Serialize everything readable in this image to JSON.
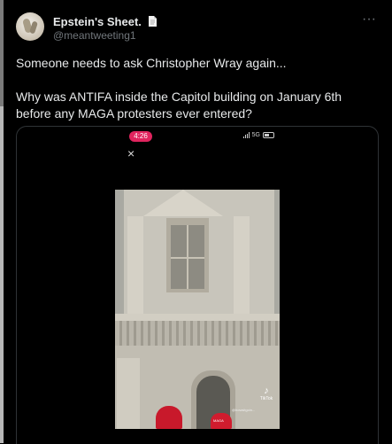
{
  "author": {
    "display_name": "Epstein's Sheet.",
    "handle": "@meantweeting1",
    "avatar_icon": "avatar-image",
    "badge_icon": "document-emoji-icon"
  },
  "header": {
    "more_icon": "more-icon",
    "more_label": "···"
  },
  "tweet": {
    "line1": "Someone needs to ask Christopher Wray again...",
    "line2": "Why was ANTIFA inside the Capitol building on January 6th before any MAGA protesters ever entered?"
  },
  "media": {
    "status_time": "4:26",
    "status_network": "5G",
    "close_label": "×",
    "tiktok_label": "TikTok",
    "tiktok_handle": "@howsitgoin...",
    "hat_text": "MAGA"
  },
  "colors": {
    "background": "#000000",
    "text": "#e7e9ea",
    "secondary": "#71767b",
    "time_pill": "#e0245e"
  }
}
